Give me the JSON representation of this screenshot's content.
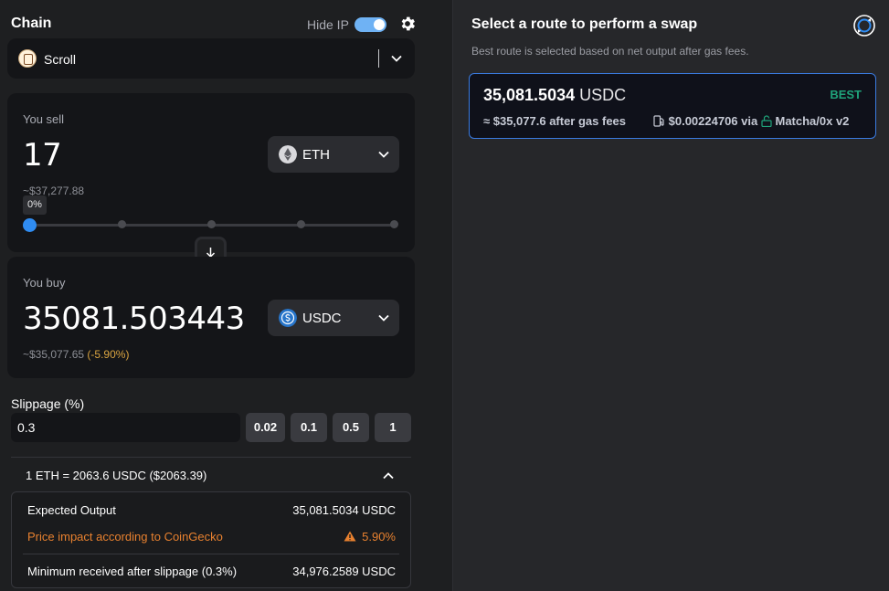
{
  "header": {
    "title": "Chain",
    "hide_ip_label": "Hide IP",
    "hide_ip_enabled": true
  },
  "chain": {
    "name": "Scroll"
  },
  "sell": {
    "label": "You sell",
    "amount": "17",
    "usd": "~$37,277.88",
    "token": "ETH",
    "slider_tip": "0%",
    "slider_value_percent": 0
  },
  "buy": {
    "label": "You buy",
    "amount": "35081.503443",
    "usd": "~$35,077.65",
    "impact": "(-5.90%)",
    "token": "USDC"
  },
  "slippage": {
    "label": "Slippage (%)",
    "value": "0.3",
    "presets": [
      "0.02",
      "0.1",
      "0.5",
      "1"
    ]
  },
  "rate": {
    "text": "1 ETH = 2063.6 USDC ($2063.39)"
  },
  "details": {
    "expected_label": "Expected Output",
    "expected_value": "35,081.5034 USDC",
    "impact_label": "Price impact according to CoinGecko",
    "impact_value": "5.90%",
    "min_label": "Minimum received after slippage (0.3%)",
    "min_value": "34,976.2589 USDC"
  },
  "routes": {
    "title": "Select a route to perform a swap",
    "subtitle": "Best route is selected based on net output after gas fees.",
    "items": [
      {
        "amount": "35,081.5034",
        "token": "USDC",
        "badge": "BEST",
        "net": "≈ $35,077.6 after gas fees",
        "gas": "$0.00224706 via",
        "provider": "Matcha/0x v2"
      }
    ]
  },
  "colors": {
    "accent": "#2f8cf2",
    "best": "#1fa37a",
    "warning": "#e8812f",
    "impact": "#d9a441"
  },
  "icons": [
    "gear-icon",
    "chevron-down-icon",
    "scroll-logo-icon",
    "eth-icon",
    "usdc-icon",
    "arrow-down-icon",
    "chevron-up-icon",
    "warning-icon",
    "refresh-icon",
    "gas-pump-icon",
    "unlock-icon"
  ]
}
